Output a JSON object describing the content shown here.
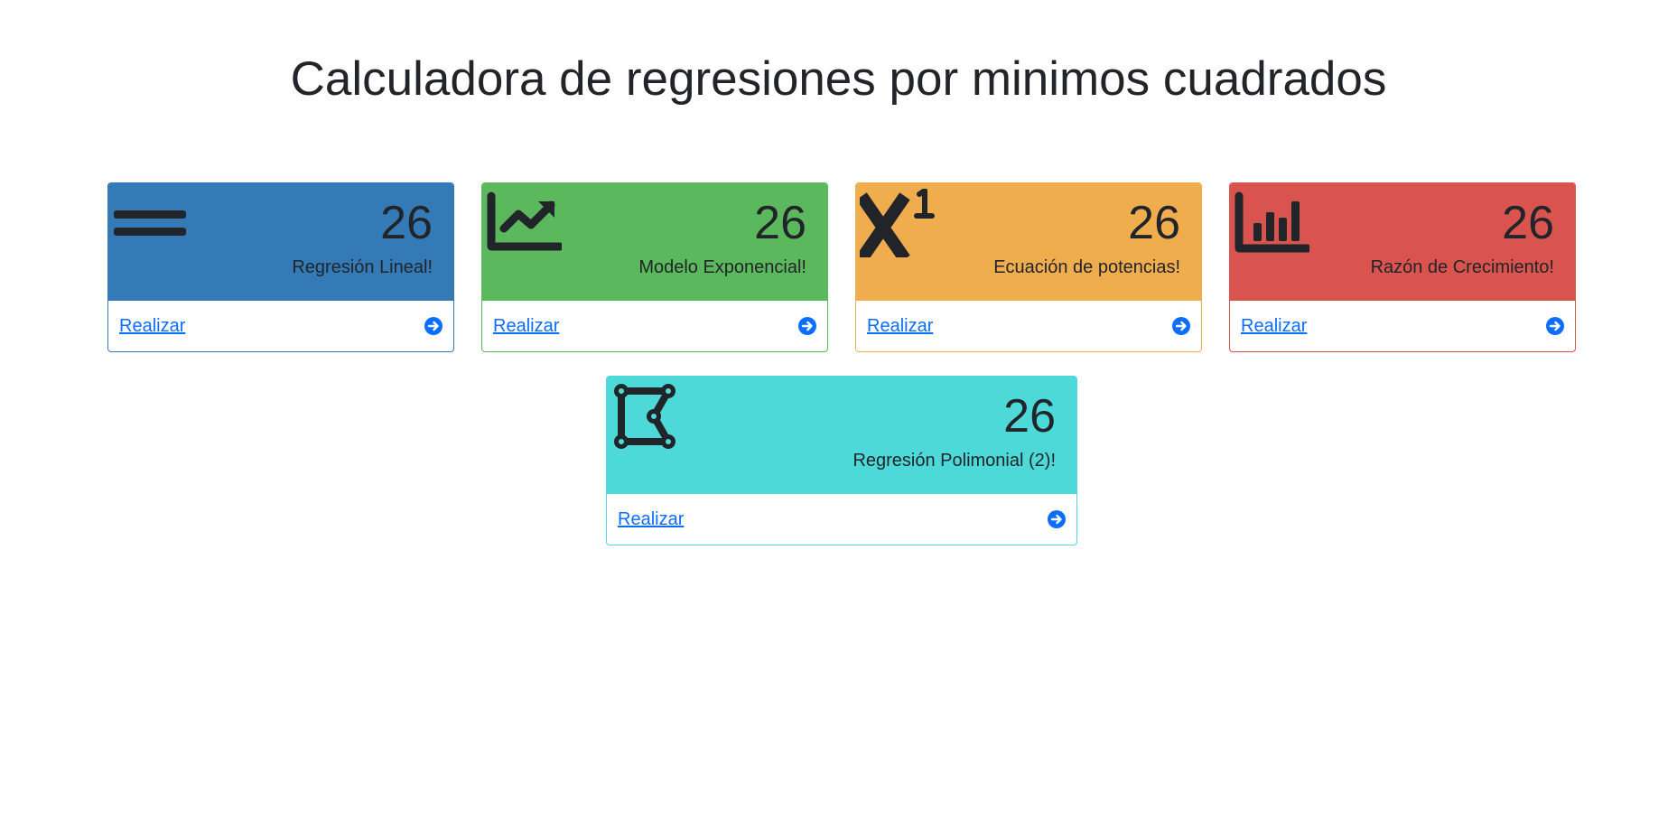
{
  "page": {
    "title": "Calculadora de regresiones por minimos cuadrados"
  },
  "cards": [
    {
      "id": "lineal",
      "count": "26",
      "label": "Regresión Lineal!",
      "link": "Realizar",
      "icon": "equals-icon",
      "color": "#337ab7"
    },
    {
      "id": "exponencial",
      "count": "26",
      "label": "Modelo Exponencial!",
      "link": "Realizar",
      "icon": "line-chart-icon",
      "color": "#5cb85c"
    },
    {
      "id": "potencias",
      "count": "26",
      "label": "Ecuación de potencias!",
      "link": "Realizar",
      "icon": "superscript-icon",
      "color": "#f0ad4e"
    },
    {
      "id": "crecimiento",
      "count": "26",
      "label": "Razón de Crecimiento!",
      "link": "Realizar",
      "icon": "bar-chart-icon",
      "color": "#d9534f"
    },
    {
      "id": "polinomial",
      "count": "26",
      "label": "Regresión Polimonial (2)!",
      "link": "Realizar",
      "icon": "bezier-polygon-icon",
      "color": "#4ed9d9"
    }
  ],
  "colors": {
    "link": "#0d6efd",
    "text": "#212529"
  }
}
